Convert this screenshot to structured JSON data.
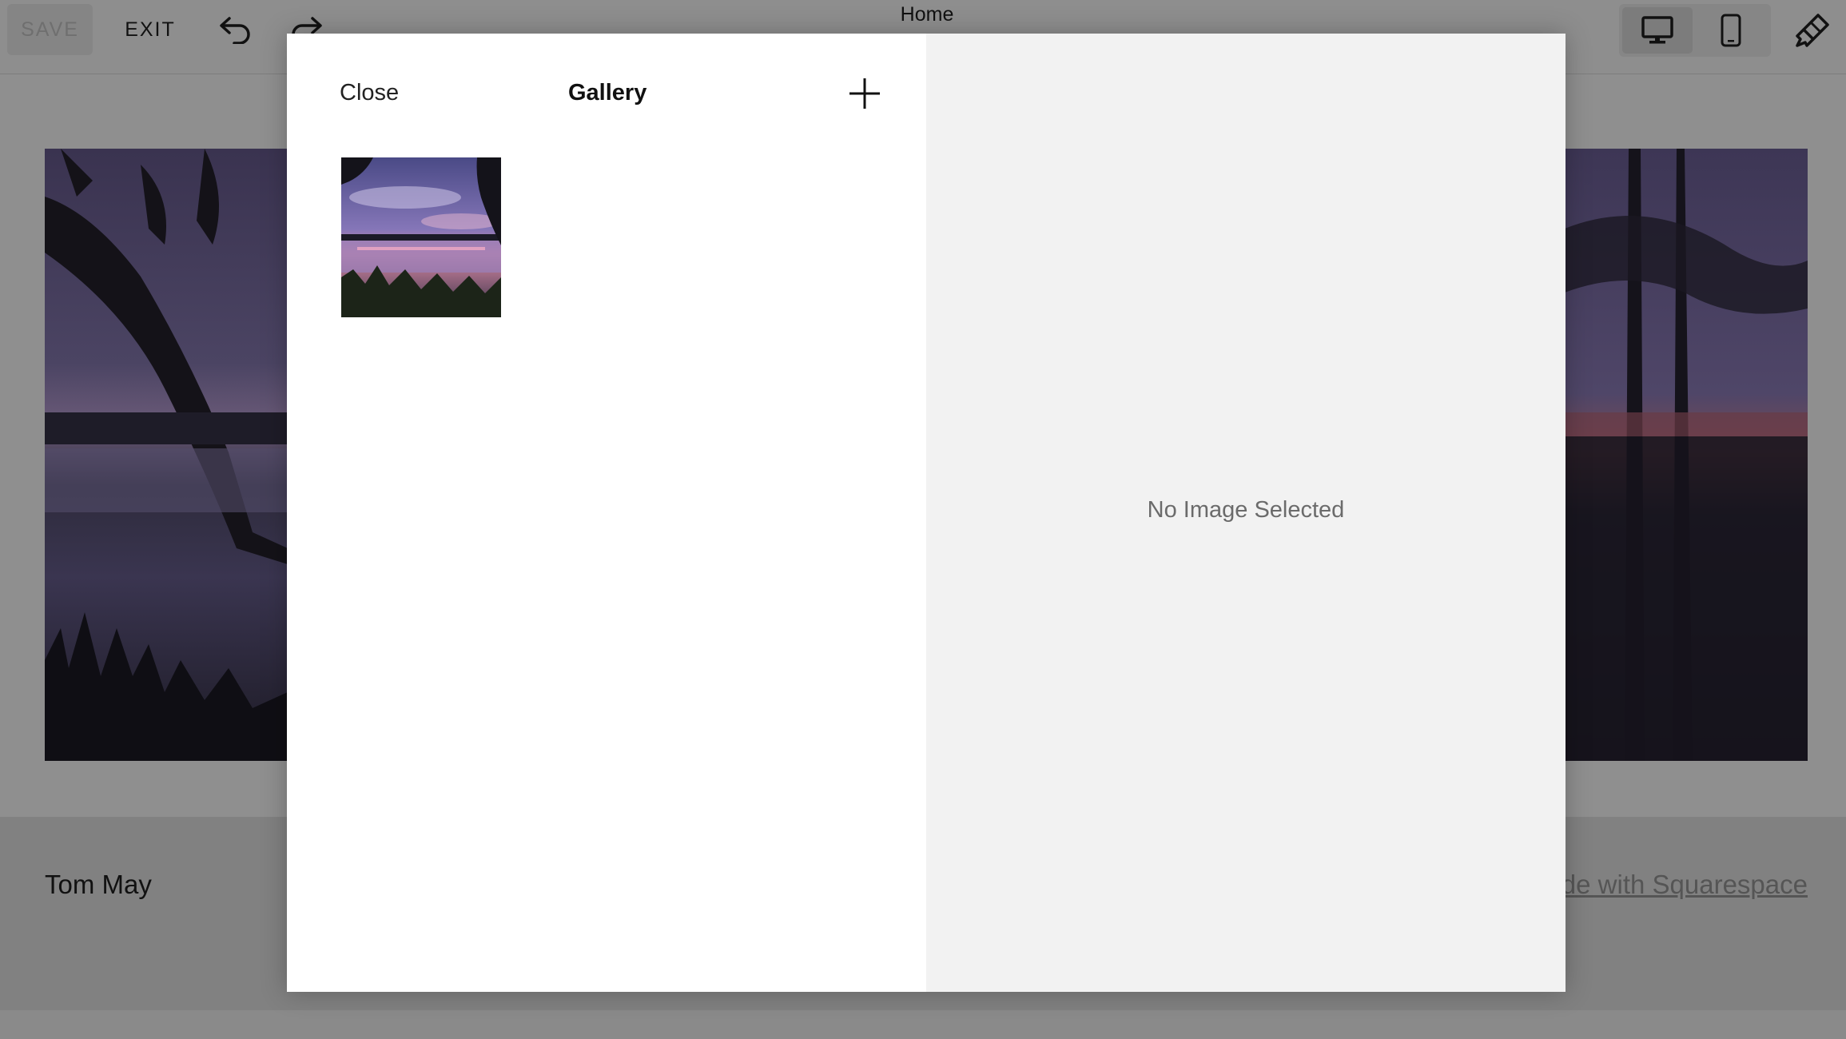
{
  "toolbar": {
    "save_label": "SAVE",
    "exit_label": "EXIT",
    "undo_icon": "undo-icon",
    "redo_icon": "redo-icon",
    "page_title": "Home",
    "device_desktop_icon": "desktop-icon",
    "device_mobile_icon": "mobile-icon",
    "style_icon": "paintbrush-icon"
  },
  "background_page": {
    "footer_name": "Tom May",
    "footer_link": "Made with Squarespace"
  },
  "modal": {
    "close_label": "Close",
    "title": "Gallery",
    "add_icon": "plus-icon",
    "preview_text": "No Image Selected"
  },
  "colors": {
    "overlay": "#8f8f8f",
    "modal_left_bg": "#ffffff",
    "modal_right_bg": "#f2f2f2",
    "accent_text": "#111111"
  }
}
